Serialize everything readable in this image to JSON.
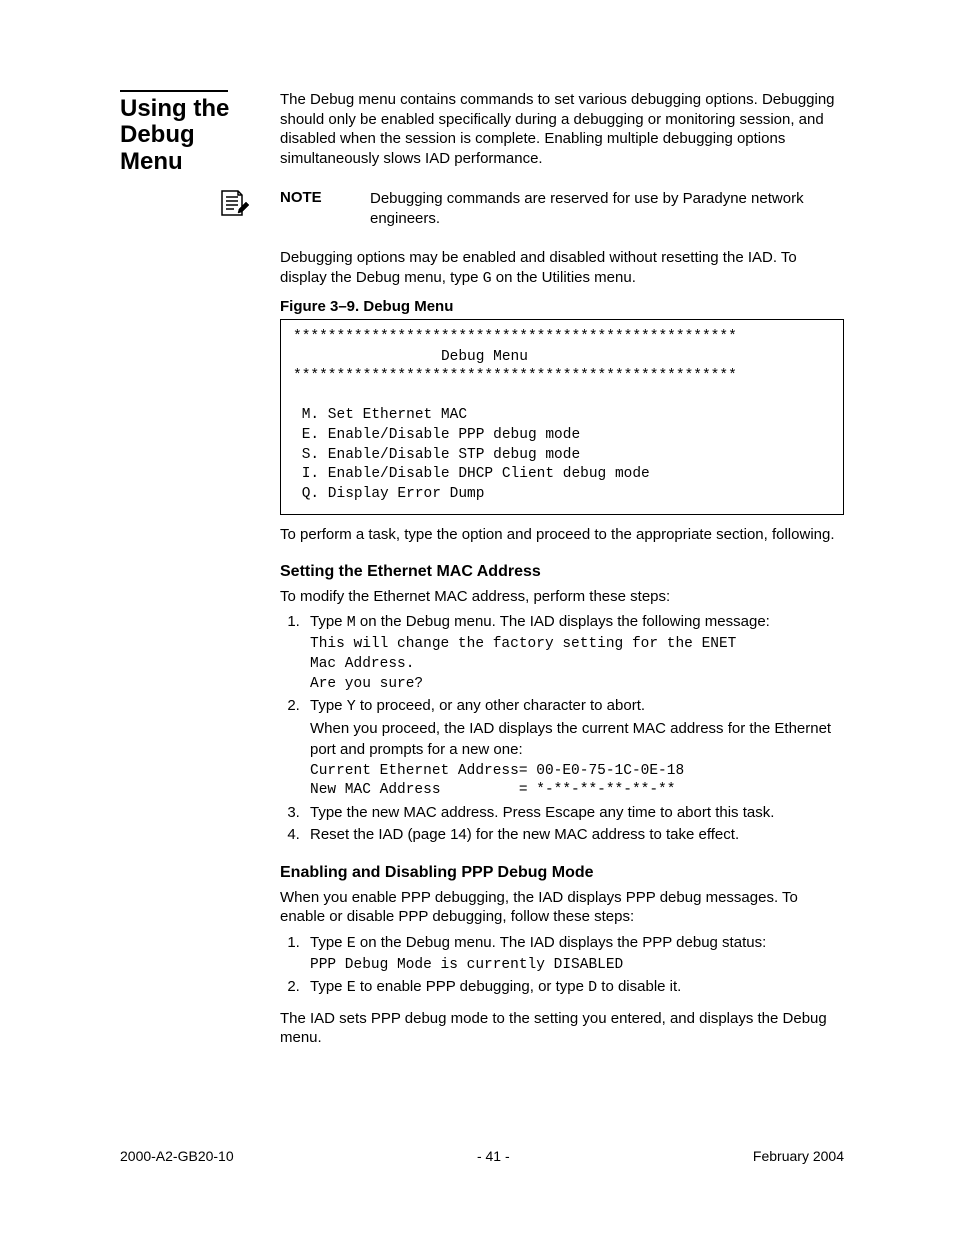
{
  "section_title": "Using the Debug Menu",
  "intro": "The Debug menu contains commands to set various debugging options. Debugging should only be enabled specifically during a debugging or monitoring session, and disabled when the session is complete. Enabling multiple debugging options simultaneously slows IAD performance.",
  "note": {
    "label": "NOTE",
    "text": "Debugging commands are reserved for use by Paradyne network engineers."
  },
  "post_note": "Debugging options may be enabled and disabled without resetting the IAD. To display the Debug menu, type ",
  "post_note_cmd": "G",
  "post_note_tail": " on the Utilities menu.",
  "figure": {
    "caption": "Figure 3–9.  Debug Menu",
    "stars": "***************************************************",
    "title": "Debug Menu",
    "items": [
      " M. Set Ethernet MAC",
      " E. Enable/Disable PPP debug mode",
      " S. Enable/Disable STP debug mode",
      " I. Enable/Disable DHCP Client debug mode",
      " Q. Display Error Dump"
    ]
  },
  "after_menu": "To perform a task, type the option and proceed to the appropriate section, following.",
  "mac": {
    "heading": "Setting the Ethernet MAC Address",
    "intro": "To modify the Ethernet MAC address, perform these steps:",
    "step1_a": "Type ",
    "step1_cmd": "M",
    "step1_b": " on the Debug menu. The IAD displays the following message:",
    "step1_code": "This will change the factory setting for the ENET\nMac Address.\nAre you sure?",
    "step2_a": "Type ",
    "step2_cmd": "Y",
    "step2_b": " to proceed, or any other character to abort.",
    "step2_c": "When you proceed, the IAD displays the current MAC address for the Ethernet port and prompts for a new one:",
    "step2_code": "Current Ethernet Address= 00-E0-75-1C-0E-18\nNew MAC Address         = *-**-**-**-**-**",
    "step3": "Type the new MAC address. Press Escape any time to abort this task.",
    "step4": "Reset the IAD (page 14) for the new MAC address to take effect."
  },
  "ppp": {
    "heading": "Enabling and Disabling PPP Debug Mode",
    "intro": "When you enable PPP debugging, the IAD displays PPP debug messages. To enable or disable PPP debugging, follow these steps:",
    "step1_a": "Type ",
    "step1_cmd": "E",
    "step1_b": " on the Debug menu. The IAD displays the PPP debug status:",
    "step1_code": "PPP Debug Mode is currently DISABLED",
    "step2_a": "Type ",
    "step2_cmd_e": "E",
    "step2_mid": " to enable PPP debugging, or type ",
    "step2_cmd_d": "D",
    "step2_tail": " to disable it.",
    "outro": "The IAD sets PPP debug mode to the setting you entered, and displays the Debug menu."
  },
  "footer": {
    "left": "2000-A2-GB20-10",
    "center": "- 41 -",
    "right": "February 2004"
  }
}
